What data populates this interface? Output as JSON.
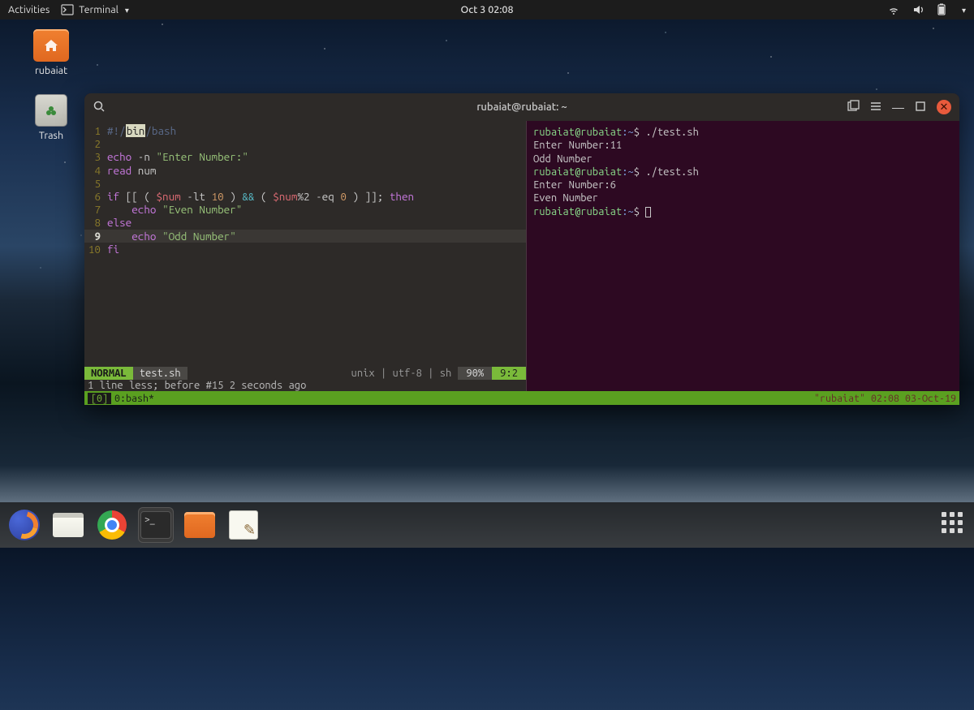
{
  "topbar": {
    "activities": "Activities",
    "app_name": "Terminal",
    "clock": "Oct 3  02:08"
  },
  "desktop": {
    "home_folder": "rubaiat",
    "trash": "Trash"
  },
  "terminal": {
    "title": "rubaiat@rubaiat: ~",
    "vim": {
      "mode": "NORMAL",
      "filename": "test.sh",
      "fileinfo": "unix | utf-8 | sh",
      "percent": "90%",
      "cursor_pos": "9:2",
      "message": "1 line less; before #15  2 seconds ago",
      "lines": [
        {
          "n": "1",
          "segs": [
            {
              "c": "cmt",
              "t": "#!/"
            },
            {
              "c": "hlbox",
              "t": "bin"
            },
            {
              "c": "cmt",
              "t": "/bash"
            }
          ]
        },
        {
          "n": "2",
          "segs": []
        },
        {
          "n": "3",
          "segs": [
            {
              "c": "kw",
              "t": "echo"
            },
            {
              "c": "",
              "t": " -n "
            },
            {
              "c": "str",
              "t": "\"Enter Number:\""
            }
          ]
        },
        {
          "n": "4",
          "segs": [
            {
              "c": "kw",
              "t": "read"
            },
            {
              "c": "",
              "t": " num"
            }
          ]
        },
        {
          "n": "5",
          "segs": []
        },
        {
          "n": "6",
          "segs": [
            {
              "c": "kw",
              "t": "if"
            },
            {
              "c": "",
              "t": " [[ ( "
            },
            {
              "c": "var",
              "t": "$num"
            },
            {
              "c": "",
              "t": " -lt "
            },
            {
              "c": "num-lit",
              "t": "10"
            },
            {
              "c": "",
              "t": " ) "
            },
            {
              "c": "op",
              "t": "&&"
            },
            {
              "c": "",
              "t": " ( "
            },
            {
              "c": "var",
              "t": "$num"
            },
            {
              "c": "",
              "t": "%2 -eq "
            },
            {
              "c": "num-lit",
              "t": "0"
            },
            {
              "c": "",
              "t": " ) ]]; "
            },
            {
              "c": "kw",
              "t": "then"
            }
          ]
        },
        {
          "n": "7",
          "segs": [
            {
              "c": "",
              "t": "    "
            },
            {
              "c": "kw",
              "t": "echo"
            },
            {
              "c": "",
              "t": " "
            },
            {
              "c": "str",
              "t": "\"Even Number\""
            }
          ]
        },
        {
          "n": "8",
          "segs": [
            {
              "c": "kw",
              "t": "else"
            }
          ]
        },
        {
          "n": "9",
          "segs": [
            {
              "c": "",
              "t": "    "
            },
            {
              "c": "kw",
              "t": "echo"
            },
            {
              "c": "",
              "t": " "
            },
            {
              "c": "str",
              "t": "\"Odd Number\""
            }
          ],
          "current": true
        },
        {
          "n": "10",
          "segs": [
            {
              "c": "kw",
              "t": "fi"
            }
          ]
        }
      ]
    },
    "shell": {
      "prompt_user": "rubaiat@rubaiat",
      "prompt_path": ":~",
      "prompt_sym": "$",
      "lines": [
        {
          "type": "prompt",
          "cmd": "./test.sh"
        },
        {
          "type": "out",
          "text": "Enter Number:11"
        },
        {
          "type": "out",
          "text": "Odd Number"
        },
        {
          "type": "prompt",
          "cmd": "./test.sh"
        },
        {
          "type": "out",
          "text": "Enter Number:6"
        },
        {
          "type": "out",
          "text": "Even Number"
        },
        {
          "type": "prompt",
          "cmd": "",
          "cursor": true
        }
      ]
    },
    "tmux": {
      "session": "[0]",
      "window": "0:bash*",
      "status_right": "\"rubaiat\" 02:08 03-Oct-19"
    }
  },
  "dock": {
    "items": [
      "firefox",
      "files",
      "chrome",
      "terminal",
      "folder",
      "text-editor"
    ]
  }
}
